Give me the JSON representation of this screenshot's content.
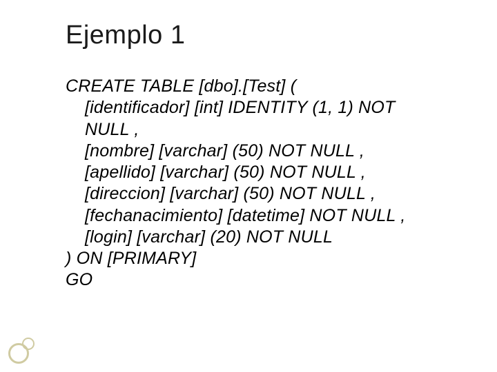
{
  "slide": {
    "title": "Ejemplo 1",
    "code": {
      "l0": "CREATE TABLE [dbo].[Test] (",
      "l1": "[identificador] [int] IDENTITY (1, 1) NOT NULL ,",
      "l2": "[nombre] [varchar] (50) NOT NULL ,",
      "l3": "[apellido] [varchar] (50) NOT NULL ,",
      "l4": "[direccion] [varchar] (50) NOT NULL ,",
      "l5": "[fechanacimiento] [datetime] NOT NULL ,",
      "l6": "[login] [varchar] (20) NOT NULL",
      "l7": ") ON [PRIMARY]",
      "l8": "GO"
    }
  }
}
